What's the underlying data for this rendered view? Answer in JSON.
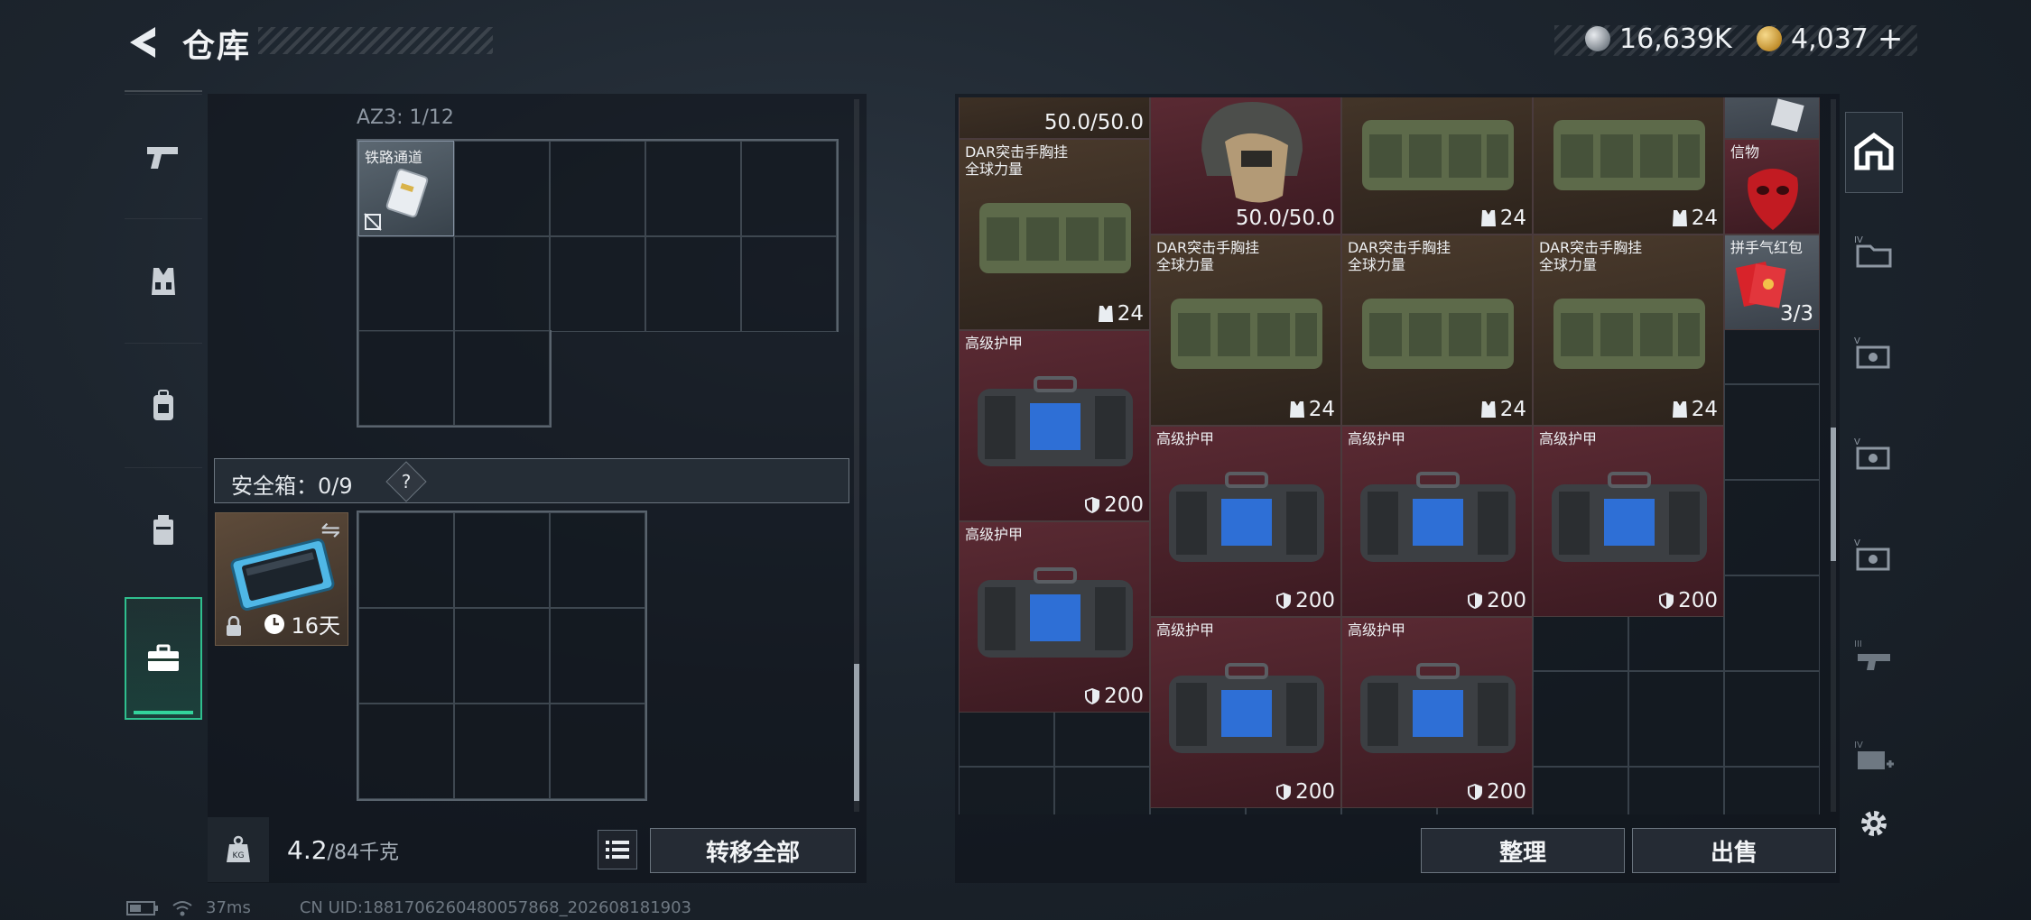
{
  "header": {
    "title": "仓库",
    "currency_silver": "16,639K",
    "currency_gold": "4,037",
    "plus_label": "+"
  },
  "left_nav": {
    "items": [
      "pistol-icon",
      "vest-icon",
      "backpack-icon",
      "pouch-icon",
      "case-icon"
    ],
    "active_index": 4
  },
  "container": {
    "label": "AZ3: 1/12",
    "item": {
      "name": "铁路通道"
    }
  },
  "safebox": {
    "label": "安全箱：0/9",
    "help": "?",
    "duration": "16天",
    "swap": "⇋"
  },
  "weight": {
    "current": "4.2",
    "max": "/84千克"
  },
  "buttons": {
    "transfer_all": "转移全部",
    "organize": "整理",
    "sell": "出售"
  },
  "stash": {
    "top_value": "50.0/50.0",
    "helmet_value": "50.0/50.0",
    "rig_name_1": "DAR突击手胸挂",
    "rig_name_2": "全球力量",
    "rig_value": "24",
    "armor_name": "高级护甲",
    "armor_value": "200",
    "token_name": "信物",
    "redpack_name": "拼手气红包",
    "redpack_value": "3/3"
  },
  "footer": {
    "ping": "37ms",
    "uid": "CN UID:1881706260480057868_202608181903"
  },
  "colors": {
    "accent": "#33d49c",
    "armor_bg": "#5a2a33",
    "rig_bg": "#4a3a2c"
  }
}
